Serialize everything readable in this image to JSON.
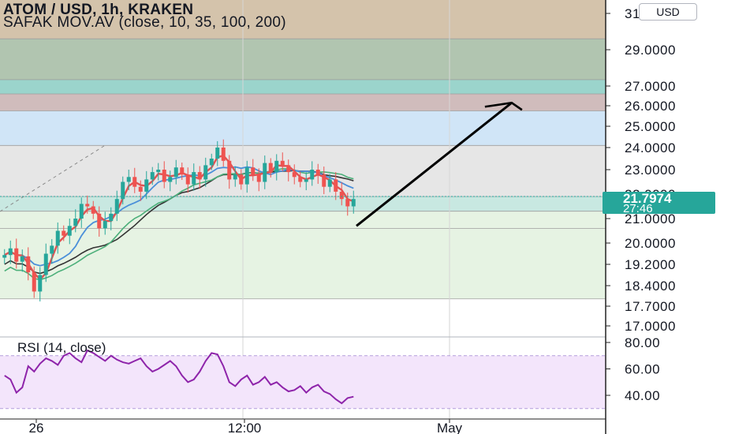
{
  "header": {
    "title": "ATOM / USD, 1h, KRAKEN",
    "indicator": "SAFAK  MOV.AV (close, 10, 35, 100, 200)",
    "currency": "USD"
  },
  "price_tag": {
    "price": "21.7974",
    "countdown": "27:46"
  },
  "rsi_label": "RSI (14, close)",
  "colors": {
    "up": "#26a69a",
    "down": "#ef5350",
    "ma10": "#e05252",
    "ma35": "#4a8fd9",
    "ma100": "#4caf7a",
    "ma200": "#333333",
    "rsi": "#8e24aa",
    "arrow": "#000000"
  },
  "chart_data": {
    "type": "candlestick",
    "symbol": "ATOM / USD",
    "interval": "1h",
    "exchange": "KRAKEN",
    "x_ticks": [
      "26",
      "12:00",
      "May"
    ],
    "y_ticks": [
      "31.0000",
      "29.0000",
      "27.0000",
      "26.0000",
      "25.0000",
      "24.0000",
      "23.0000",
      "22.0000",
      "21.0000",
      "20.0000",
      "19.2000",
      "18.4000",
      "17.7000",
      "17.0000"
    ],
    "last_price": 21.7974,
    "price_zones": [
      {
        "low": 29.6,
        "high": 31.4,
        "color": "#d4c3ab"
      },
      {
        "low": 27.35,
        "high": 29.6,
        "color": "#b1c5b0"
      },
      {
        "low": 26.6,
        "high": 27.35,
        "color": "#9bd4cc"
      },
      {
        "low": 25.75,
        "high": 26.6,
        "color": "#d0bcbc"
      },
      {
        "low": 24.1,
        "high": 25.75,
        "color": "#d0e5f7"
      },
      {
        "low": 21.9,
        "high": 24.1,
        "color": "#e6e6e6"
      },
      {
        "low": 21.3,
        "high": 21.9,
        "color": "#c8e8e1"
      },
      {
        "low": 17.95,
        "high": 21.3,
        "color": "#e6f3e3"
      }
    ],
    "zone_lines": [
      29.6,
      27.35,
      26.6,
      25.75,
      24.1,
      21.9,
      21.3,
      20.6,
      17.95
    ],
    "close_series": [
      19.55,
      19.8,
      19.3,
      19.5,
      18.9,
      18.2,
      18.8,
      19.6,
      19.9,
      20.5,
      20.3,
      20.7,
      21.0,
      21.6,
      21.5,
      21.2,
      20.6,
      20.9,
      21.2,
      21.8,
      22.5,
      22.7,
      22.3,
      22.1,
      22.6,
      22.9,
      23.0,
      22.5,
      22.7,
      23.1,
      22.8,
      22.4,
      22.9,
      22.6,
      23.2,
      23.5,
      24.0,
      23.4,
      22.6,
      22.8,
      22.4,
      23.1,
      22.8,
      22.5,
      23.3,
      22.9,
      23.4,
      23.2,
      22.9,
      22.7,
      22.5,
      22.6,
      23.0,
      22.8,
      22.3,
      22.6,
      22.1,
      21.8,
      21.5,
      21.8
    ],
    "x_data_range": [
      0,
      64
    ],
    "arrow": {
      "from": {
        "x": 64,
        "y": 20.7
      },
      "to": {
        "x": 92,
        "y": 26.15
      }
    },
    "rsi": {
      "label": "RSI (14, close)",
      "y_ticks": [
        "80.00",
        "60.00",
        "40.00"
      ],
      "band": [
        30,
        70
      ],
      "values": [
        55,
        52,
        42,
        46,
        62,
        58,
        64,
        68,
        66,
        63,
        70,
        72,
        68,
        65,
        74,
        72,
        69,
        66,
        70,
        67,
        65,
        64,
        66,
        68,
        62,
        58,
        60,
        63,
        66,
        62,
        55,
        50,
        52,
        58,
        66,
        72,
        71,
        62,
        50,
        47,
        52,
        55,
        48,
        50,
        54,
        48,
        50,
        46,
        43,
        44,
        47,
        42,
        46,
        48,
        43,
        41,
        37,
        34,
        38,
        39
      ]
    }
  }
}
